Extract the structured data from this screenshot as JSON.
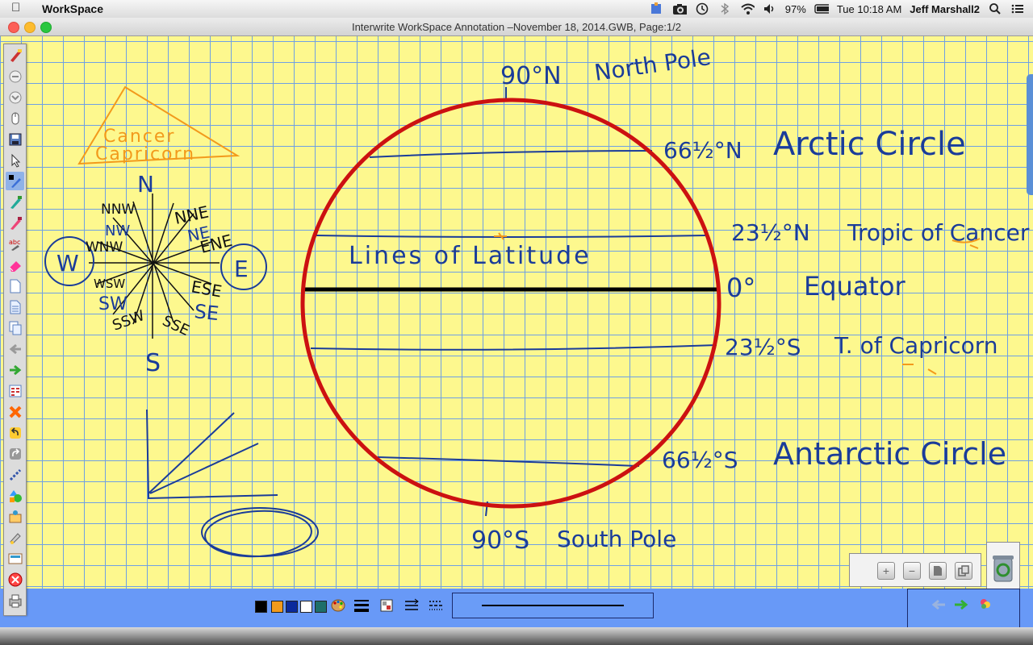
{
  "menubar": {
    "apple_icon": "apple-icon",
    "app_name": "WorkSpace",
    "battery": "97%",
    "time": "Tue 10:18 AM",
    "user": "Jeff Marshall2"
  },
  "window": {
    "title": "Interwrite WorkSpace Annotation –November 18, 2014.GWB, Page:1/2"
  },
  "annotation": {
    "north_pole_label": "90°N",
    "north_pole_name": "North Pole",
    "arctic_label": "66½°N",
    "arctic_name": "Arctic Circle",
    "cancer_label": "23½°N",
    "cancer_name": "Tropic of Cancer",
    "equator_label": "0°",
    "equator_name": "Equator",
    "capricorn_label": "23½°S",
    "capricorn_name": "T. of Capricorn",
    "antarctic_label": "66½°S",
    "antarctic_name": "Antarctic Circle",
    "south_pole_label": "90°S",
    "south_pole_name": "South Pole",
    "lines_label": "Lines of Latitude",
    "triangle_line1": "Cancer",
    "triangle_line2": "Capricorn",
    "compass": {
      "N": "N",
      "S": "S",
      "E": "E",
      "W": "W",
      "NNW": "NNW",
      "NW": "NW",
      "WNW": "WNW",
      "NNE": "NNE",
      "NE": "NE",
      "ENE": "ENE",
      "ESE": "ESE",
      "SE": "SE",
      "SSE": "SSE",
      "WSW": "WSW",
      "SW": "SW",
      "SSW": "SSW"
    }
  },
  "colors": {
    "paper": "#fdf88e",
    "grid": "#6fa0e4",
    "globe_outline": "#cc1111",
    "ink_blue": "#1a3c9a",
    "ink_orange": "#f29a1c",
    "toolbar_bg": "#6899f7",
    "palette": [
      "#000000",
      "#f29a1c",
      "#0a2a9c",
      "#ffffff",
      "#1e6f6a"
    ]
  },
  "toolbar": {
    "tools": [
      "pen-tool",
      "circle-tool",
      "chevron-tool",
      "mouse-tool",
      "save-tool",
      "select-tool",
      "pen-active",
      "highlighter",
      "marker",
      "text-recognition",
      "eraser",
      "new-page",
      "page-view",
      "duplicate-page",
      "previous-page",
      "next-page",
      "page-sorter",
      "clear-page",
      "undo",
      "redo",
      "link",
      "shapes",
      "insert",
      "spotlight",
      "screen-capture",
      "close-tool",
      "print"
    ]
  },
  "bottom": {
    "palette_icon": "color-palette-icon",
    "line_width_icon": "line-width-icon",
    "fill_icon": "fill-icon",
    "line_style_icon": "line-style-icon",
    "dash_icon": "dash-style-icon",
    "nav_prev_icon": "arrow-left-icon",
    "nav_next_icon": "arrow-right-icon",
    "nav_tool_icon": "paint-icon"
  },
  "zoom": {
    "zoom_in_icon": "plus-icon",
    "zoom_out_icon": "minus-icon",
    "page_icon": "page-icon",
    "copy_icon": "copy-icon",
    "trash_icon": "recycle-icon"
  }
}
